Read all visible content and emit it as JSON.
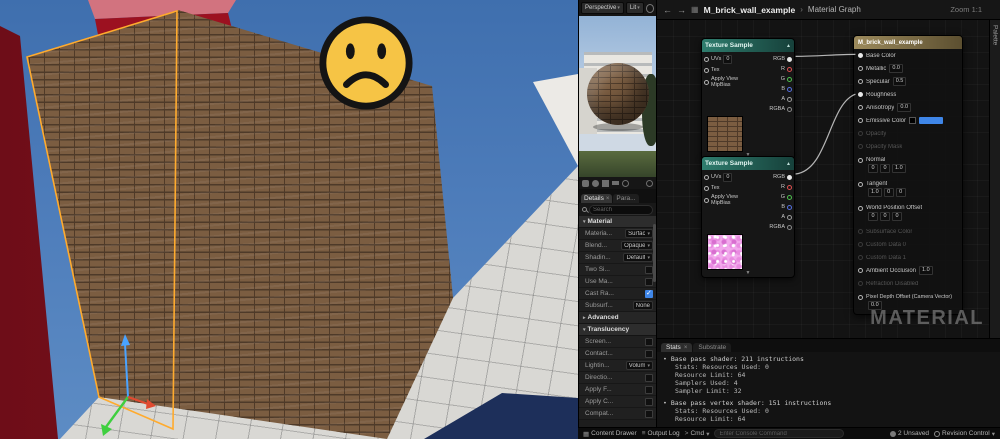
{
  "colors": {
    "selection_orange": "#ffab2e",
    "accent_blue": "#3f86e8",
    "texture_node_header": "#2f7d6e",
    "material_node_header": "#9c8a5c",
    "viewport_sky": "#4d7cba",
    "ground_navy": "#1d2f5a"
  },
  "preview": {
    "perspective_label": "Perspective",
    "lit_label": "Lit"
  },
  "details": {
    "tab_details": "Details",
    "tab_parameters": "Para...",
    "close_glyph": "×",
    "search_placeholder": "Search",
    "section_material": "Material",
    "section_advanced": "Advanced",
    "section_translucency": "Translucency",
    "material_rows": [
      {
        "label": "Materia...",
        "value": "Surfac"
      },
      {
        "label": "Blend...",
        "value": "Opaque"
      },
      {
        "label": "Shadin...",
        "value": "Default"
      },
      {
        "label": "Two Si...",
        "checked": false
      },
      {
        "label": "Use Ma...",
        "checked": false
      },
      {
        "label": "Cast Ra...",
        "checked": true
      },
      {
        "label": "Subsurf...",
        "value": "None"
      }
    ],
    "translucency_rows": [
      {
        "label": "Screen...",
        "checked": false
      },
      {
        "label": "Contact...",
        "checked": false
      },
      {
        "label": "Lightin...",
        "value": "Volum"
      },
      {
        "label": "Directio...",
        "checked": false
      },
      {
        "label": "Apply F...",
        "checked": false
      },
      {
        "label": "Apply C...",
        "checked": false
      },
      {
        "label": "Compat...",
        "checked": false
      }
    ]
  },
  "graph": {
    "back_icon": "←",
    "forward_icon": "→",
    "grid_icon": "▦",
    "breadcrumb_asset": "M_brick_wall_example",
    "breadcrumb_sep": "›",
    "breadcrumb_page": "Material Graph",
    "zoom_label": "Zoom 1:1",
    "palette_label": "Palette",
    "watermark": "MATERIAL",
    "collapse_glyph": "▲",
    "expand_glyph": "▼",
    "texture_node_title": "Texture Sample",
    "texture_inputs": [
      {
        "label": "UVs",
        "value": "0"
      },
      {
        "label": "Tex"
      },
      {
        "label": "Apply View MipBias"
      }
    ],
    "texture_outputs": [
      "RGB",
      "R",
      "G",
      "B",
      "A",
      "RGBA"
    ],
    "main_node": {
      "title": "M_brick_wall_example",
      "pins": [
        {
          "label": "Base Color",
          "kind": "connected"
        },
        {
          "label": "Metallic",
          "kind": "value",
          "value": "0.0"
        },
        {
          "label": "Specular",
          "kind": "value",
          "value": "0.5"
        },
        {
          "label": "Roughness",
          "kind": "connected"
        },
        {
          "label": "Anisotropy",
          "kind": "value",
          "value": "0.0"
        },
        {
          "label": "Emissive Color",
          "kind": "swatch"
        },
        {
          "label": "Opacity",
          "kind": "disabled"
        },
        {
          "label": "Opacity Mask",
          "kind": "disabled"
        },
        {
          "label": "Normal",
          "kind": "vec",
          "vec": [
            "0",
            "0",
            "1.0"
          ]
        },
        {
          "label": "Tangent",
          "kind": "vec",
          "vec": [
            "1.0",
            "0",
            "0"
          ]
        },
        {
          "label": "World Position Offset",
          "kind": "vec",
          "vec": [
            "0",
            "0",
            "0"
          ]
        },
        {
          "label": "Subsurface Color",
          "kind": "disabled"
        },
        {
          "label": "Custom Data 0",
          "kind": "disabled"
        },
        {
          "label": "Custom Data 1",
          "kind": "disabled"
        },
        {
          "label": "Ambient Occlusion",
          "kind": "value",
          "value": "1.0"
        },
        {
          "label": "Refraction Disabled",
          "kind": "disabled"
        },
        {
          "label": "Pixel Depth Offset (Camera Vector)",
          "kind": "value-below",
          "value": "0.0"
        }
      ]
    }
  },
  "stats": {
    "tab_stats": "Stats",
    "tab_substrate": "Substrate",
    "close_glyph": "×",
    "blocks": [
      {
        "title": "Base pass shader: 211 instructions",
        "lines": [
          "Stats: Resources Used: 0",
          "Resource Limit: 64",
          "Samplers Used: 4",
          "Sampler Limit: 32"
        ]
      },
      {
        "title": "Base pass vertex shader: 151 instructions",
        "lines": [
          "Stats: Resources Used: 0",
          "Resource Limit: 64"
        ]
      }
    ]
  },
  "bottom_bar": {
    "content_drawer_icon": "▦",
    "content_drawer": "Content Drawer",
    "output_log_icon": "≡",
    "output_log": "Output Log",
    "cmd_icon": ">",
    "cmd": "Cmd",
    "console_placeholder": "Enter Console Command",
    "unsaved": "2 Unsaved",
    "revision_control": "Revision Control"
  }
}
